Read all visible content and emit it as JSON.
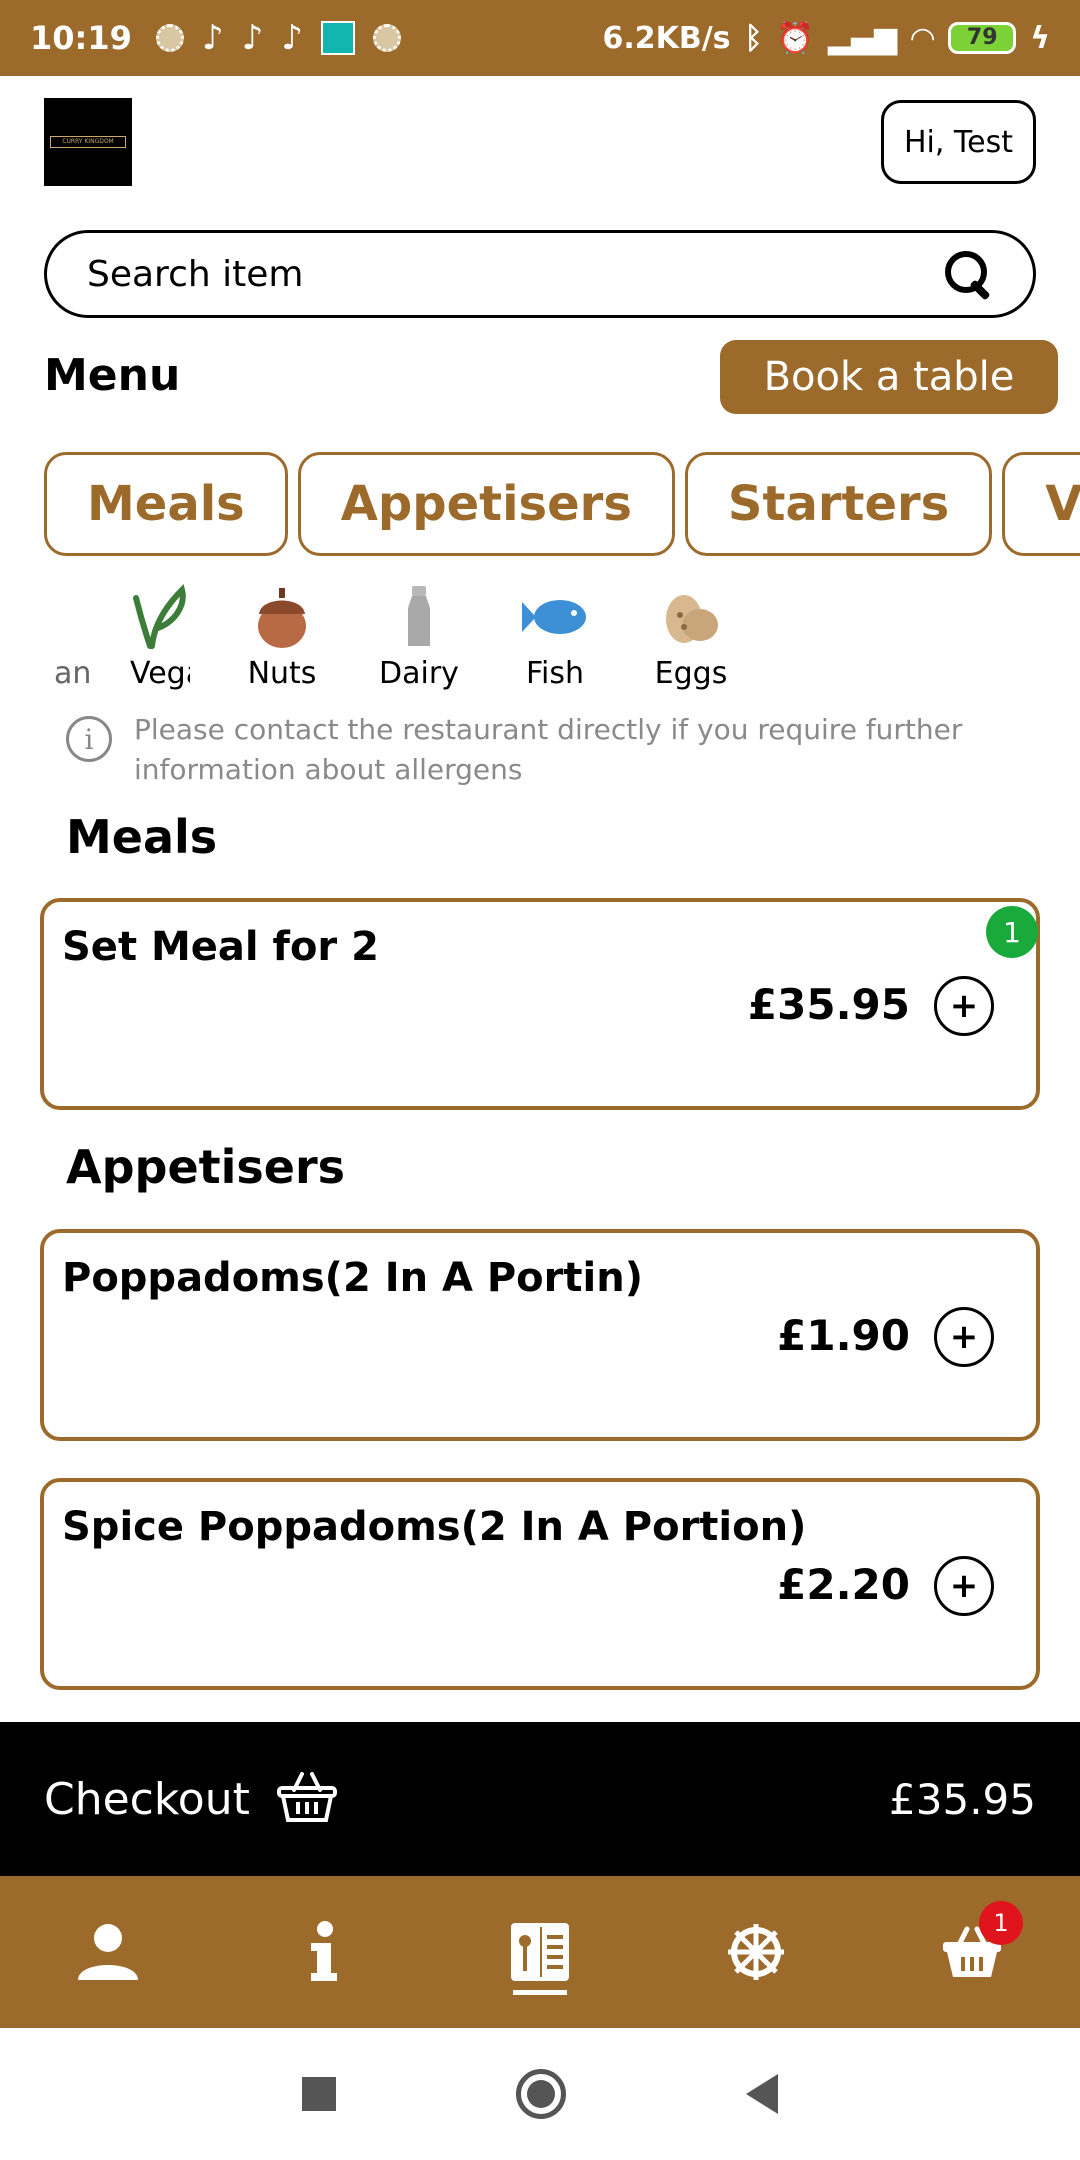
{
  "status_bar": {
    "time": "10:19",
    "network_speed": "6.2KB/s",
    "battery_level": "79"
  },
  "header": {
    "logo_text": "CURRY KINGDOM",
    "greeting": "Hi, Test"
  },
  "search": {
    "placeholder": "Search item"
  },
  "menu": {
    "title": "Menu",
    "book_table_label": "Book a table"
  },
  "categories": [
    "Meals",
    "Appetisers",
    "Starters",
    "Vegetarian"
  ],
  "allergens": [
    {
      "label": "an",
      "icon": "partial-icon"
    },
    {
      "label": "Vegan",
      "icon": "vegan-leaf-icon"
    },
    {
      "label": "Nuts",
      "icon": "nut-icon"
    },
    {
      "label": "Dairy",
      "icon": "milk-bottle-icon"
    },
    {
      "label": "Fish",
      "icon": "fish-icon"
    },
    {
      "label": "Eggs",
      "icon": "egg-icon"
    }
  ],
  "allergen_notice": "Please contact the restaurant directly if you require further information about allergens",
  "sections": [
    {
      "title": "Meals",
      "items": [
        {
          "name": "Set Meal for 2",
          "price": "£35.95",
          "quantity": "1"
        }
      ]
    },
    {
      "title": "Appetisers",
      "items": [
        {
          "name": "Poppadoms(2 In A Portin)",
          "price": "£1.90"
        },
        {
          "name": "Spice Poppadoms(2 In A Portion)",
          "price": "£2.20"
        }
      ]
    }
  ],
  "add_label": "+",
  "checkout": {
    "label": "Checkout",
    "total": "£35.95"
  },
  "bottom_nav": {
    "items": [
      "profile-icon",
      "info-icon",
      "menu-book-icon",
      "settings-wheel-icon",
      "basket-icon"
    ],
    "active": "menu-book-icon",
    "basket_badge": "1"
  },
  "colors": {
    "brand": "#9c6b2c",
    "checkout_bg": "#000000",
    "quantity_badge": "#1aaa3c",
    "cart_badge": "#e0141c"
  }
}
